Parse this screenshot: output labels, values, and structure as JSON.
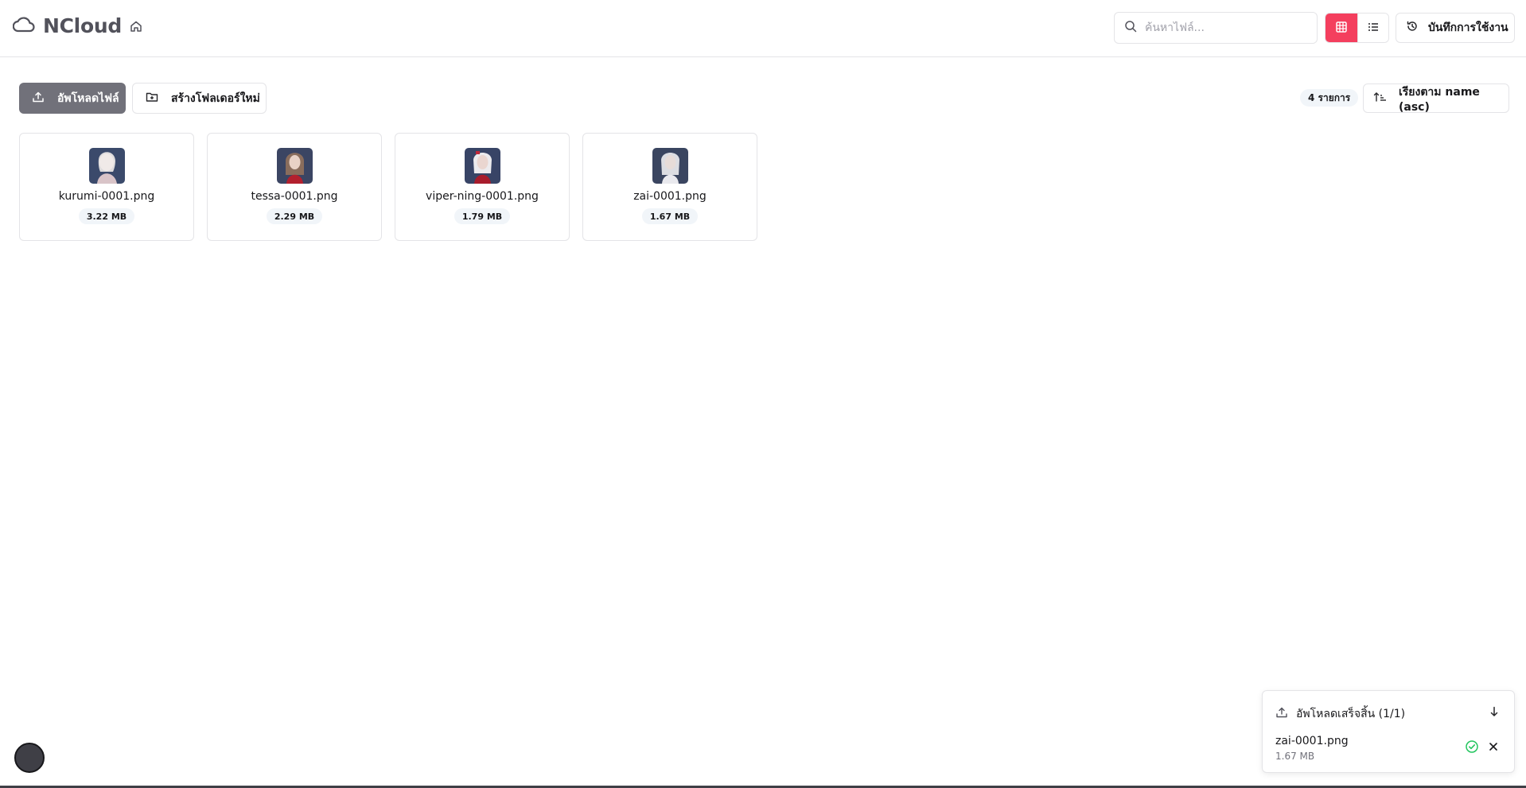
{
  "app": {
    "title": "NCloud"
  },
  "search": {
    "placeholder": "ค้นหาไฟล์...",
    "value": ""
  },
  "header": {
    "history_label": "บันทึกการใช้งาน"
  },
  "toolbar": {
    "upload_label": "อัพโหลดไฟล์",
    "new_folder_label": "สร้างโฟลเดอร์ใหม่",
    "count_label": "4 รายการ",
    "sort_label": "เรียงตาม name (asc)"
  },
  "files": [
    {
      "name": "kurumi-0001.png",
      "size": "3.22 MB"
    },
    {
      "name": "tessa-0001.png",
      "size": "2.29 MB"
    },
    {
      "name": "viper-ning-0001.png",
      "size": "1.79 MB"
    },
    {
      "name": "zai-0001.png",
      "size": "1.67 MB"
    }
  ],
  "upload_panel": {
    "title": "อัพโหลดเสร็จสิ้น (1/1)",
    "file_name": "zai-0001.png",
    "file_size": "1.67 MB"
  },
  "colors": {
    "accent": "#f43f5e",
    "primary_button": "#71717a",
    "success": "#22c55e",
    "border": "#e4e4e7"
  },
  "icons": [
    "cloud-icon",
    "home-icon",
    "search-icon",
    "grid-icon",
    "list-icon",
    "history-icon",
    "upload-icon",
    "folder-plus-icon",
    "sort-asc-icon",
    "arrow-down-icon",
    "check-circle-icon",
    "close-icon"
  ]
}
